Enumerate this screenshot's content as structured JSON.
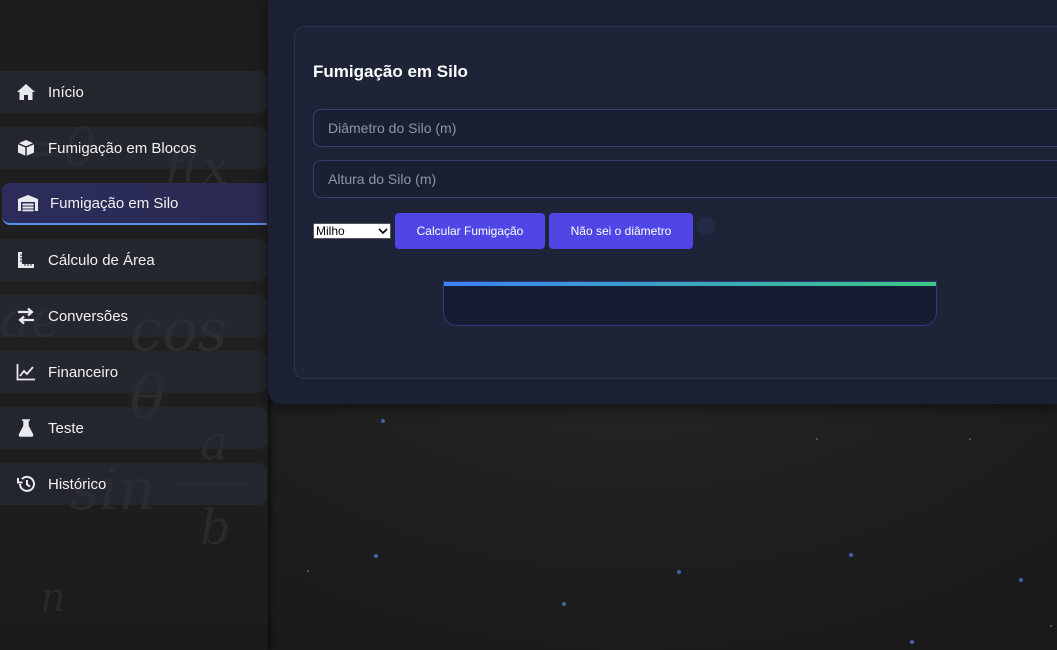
{
  "sidebar": {
    "items": [
      {
        "label": "Início",
        "icon": "home-icon",
        "active": false
      },
      {
        "label": "Fumigação em Blocos",
        "icon": "cube-icon",
        "active": false
      },
      {
        "label": "Fumigação em Silo",
        "icon": "warehouse-icon",
        "active": true
      },
      {
        "label": "Cálculo de Área",
        "icon": "ruler-icon",
        "active": false
      },
      {
        "label": "Conversões",
        "icon": "arrows-exchange-icon",
        "active": false
      },
      {
        "label": "Financeiro",
        "icon": "chart-line-icon",
        "active": false
      },
      {
        "label": "Teste",
        "icon": "flask-icon",
        "active": false
      },
      {
        "label": "Histórico",
        "icon": "history-icon",
        "active": false
      }
    ]
  },
  "main": {
    "title": "Fumigação em Silo",
    "diameter_placeholder": "Diâmetro do Silo (m)",
    "height_placeholder": "Altura do Silo (m)",
    "grain_select_value": "Milho",
    "calculate_label": "Calcular Fumigação",
    "unknown_diameter_label": "Não sei o diâmetro"
  },
  "colors": {
    "accent": "#4f46e5",
    "active_nav_underline": "#5a8fe6",
    "result_bar_start": "#3b82f6",
    "result_bar_end": "#3cc983"
  }
}
